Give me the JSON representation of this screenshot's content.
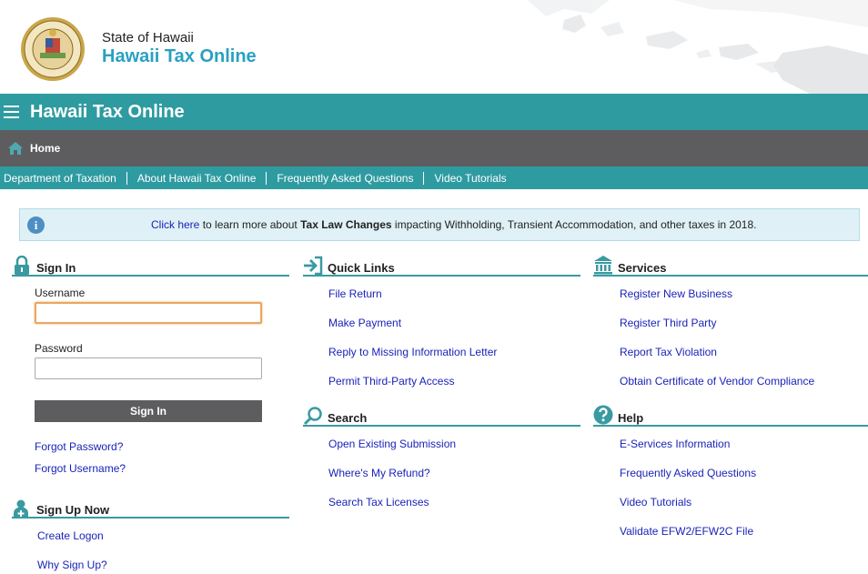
{
  "header": {
    "state_name": "State of Hawaii",
    "site_name": "Hawaii Tax Online"
  },
  "titlebar": {
    "title": "Hawaii Tax Online",
    "menu_icon": "hamburger-icon"
  },
  "homebar": {
    "home_label": "Home",
    "icon": "home-icon"
  },
  "linkbar": {
    "items": [
      "Department of Taxation",
      "About Hawaii Tax Online",
      "Frequently Asked Questions",
      "Video Tutorials"
    ]
  },
  "banner": {
    "link_text": "Click here",
    "text_1": " to learn more about ",
    "bold_text": "Tax Law Changes",
    "text_2": " impacting Withholding, Transient Accommodation, and other taxes in 2018."
  },
  "sign_in": {
    "title": "Sign In",
    "username_label": "Username",
    "username_value": "",
    "password_label": "Password",
    "password_value": "",
    "button_label": "Sign In",
    "forgot_password": "Forgot Password?",
    "forgot_username": "Forgot Username?"
  },
  "sign_up": {
    "title": "Sign Up Now",
    "create_logon": "Create Logon",
    "why_sign_up": "Why Sign Up?"
  },
  "quick_links": {
    "title": "Quick Links",
    "items": [
      "File Return",
      "Make Payment",
      "Reply to Missing Information Letter",
      "Permit Third-Party Access"
    ]
  },
  "search": {
    "title": "Search",
    "items": [
      "Open Existing Submission",
      "Where's My Refund?",
      "Search Tax Licenses"
    ]
  },
  "services": {
    "title": "Services",
    "items": [
      "Register New Business",
      "Register Third Party",
      "Report Tax Violation",
      "Obtain Certificate of Vendor Compliance"
    ]
  },
  "help": {
    "title": "Help",
    "items": [
      "E-Services Information",
      "Frequently Asked Questions",
      "Video Tutorials",
      "Validate EFW2/EFW2C File"
    ]
  },
  "colors": {
    "teal": "#2e9ba1",
    "gray_bar": "#5d5d5f",
    "link": "#1a23b8",
    "brand_blue": "#2aa0c2"
  }
}
